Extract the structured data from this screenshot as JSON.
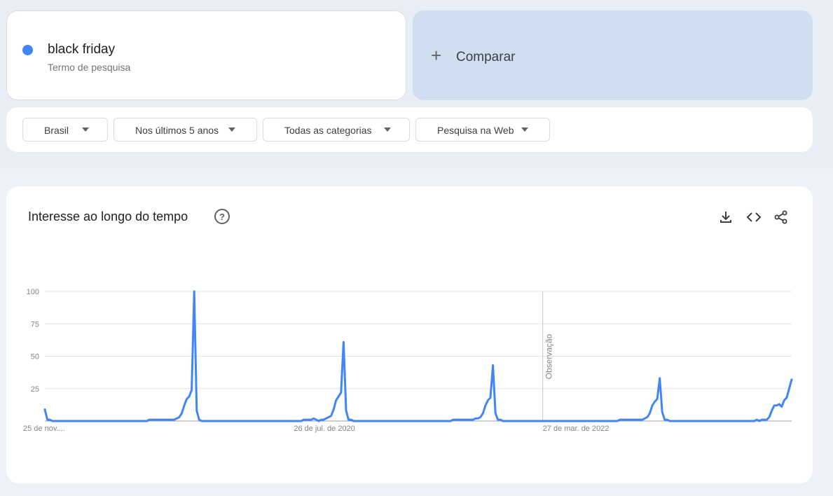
{
  "term": {
    "name": "black friday",
    "subtitle": "Termo de pesquisa",
    "color": "#4285f4"
  },
  "compare": {
    "plus": "+",
    "label": "Comparar"
  },
  "filters": [
    {
      "label": "Brasil"
    },
    {
      "label": "Nos últimos 5 anos"
    },
    {
      "label": "Todas as categorias"
    },
    {
      "label": "Pesquisa na Web"
    }
  ],
  "chart_panel": {
    "title": "Interesse ao longo do tempo",
    "help_glyph": "?",
    "tools": [
      "download-icon",
      "embed-icon",
      "share-icon"
    ]
  },
  "chart_data": {
    "type": "line",
    "title": "Interesse ao longo do tempo",
    "xlabel": "",
    "ylabel": "",
    "ylim": [
      0,
      100
    ],
    "y_ticks": [
      100,
      75,
      50,
      25
    ],
    "x_tick_labels": [
      "25 de nov....",
      "26 de jul. de 2020",
      "27 de mar. de 2022"
    ],
    "annotation": "Observação",
    "grid": true,
    "series": [
      {
        "color": "#4285f4",
        "values": [
          9,
          1,
          1,
          0,
          0,
          0,
          0,
          0,
          0,
          0,
          0,
          0,
          0,
          0,
          0,
          0,
          0,
          0,
          0,
          0,
          0,
          0,
          0,
          0,
          0,
          0,
          0,
          0,
          0,
          0,
          0,
          0,
          0,
          0,
          0,
          0,
          0,
          0,
          0,
          0,
          0,
          0,
          1,
          1,
          1,
          1,
          1,
          1,
          1,
          1,
          1,
          1,
          1,
          2,
          3,
          6,
          12,
          17,
          19,
          24,
          100,
          8,
          1,
          0,
          0,
          0,
          0,
          0,
          0,
          0,
          0,
          0,
          0,
          0,
          0,
          0,
          0,
          0,
          0,
          0,
          0,
          0,
          0,
          0,
          0,
          0,
          0,
          0,
          0,
          0,
          0,
          0,
          0,
          0,
          0,
          0,
          0,
          0,
          0,
          0,
          0,
          0,
          0,
          0,
          1,
          1,
          1,
          1,
          2,
          1,
          0,
          1,
          1,
          2,
          3,
          4,
          9,
          16,
          19,
          22,
          61,
          8,
          1,
          1,
          0,
          0,
          0,
          0,
          0,
          0,
          0,
          0,
          0,
          0,
          0,
          0,
          0,
          0,
          0,
          0,
          0,
          0,
          0,
          0,
          0,
          0,
          0,
          0,
          0,
          0,
          0,
          0,
          0,
          0,
          0,
          0,
          0,
          0,
          0,
          0,
          0,
          0,
          0,
          0,
          1,
          1,
          1,
          1,
          1,
          1,
          1,
          1,
          1,
          2,
          2,
          3,
          6,
          12,
          16,
          18,
          43,
          6,
          1,
          1,
          0,
          0,
          0,
          0,
          0,
          0,
          0,
          0,
          0,
          0,
          0,
          0,
          0,
          0,
          0,
          0,
          0,
          0,
          0,
          0,
          0,
          0,
          0,
          0,
          0,
          0,
          0,
          0,
          0,
          0,
          0,
          0,
          0,
          0,
          0,
          0,
          0,
          0,
          0,
          0,
          0,
          0,
          0,
          0,
          0,
          0,
          0,
          1,
          1,
          1,
          1,
          1,
          1,
          1,
          1,
          1,
          1,
          2,
          3,
          6,
          12,
          15,
          17,
          33,
          7,
          1,
          1,
          0,
          0,
          0,
          0,
          0,
          0,
          0,
          0,
          0,
          0,
          0,
          0,
          0,
          0,
          0,
          0,
          0,
          0,
          0,
          0,
          0,
          0,
          0,
          0,
          0,
          0,
          0,
          0,
          0,
          0,
          0,
          0,
          0,
          0,
          0,
          1,
          0,
          1,
          1,
          1,
          3,
          8,
          12,
          12,
          13,
          11,
          16,
          18,
          25,
          32
        ]
      }
    ]
  }
}
